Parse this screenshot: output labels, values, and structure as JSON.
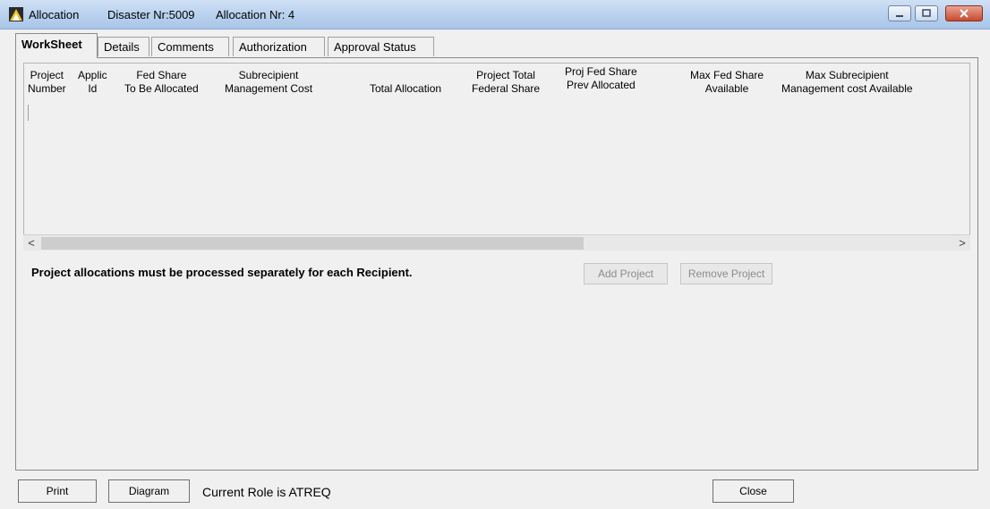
{
  "window": {
    "app_name": "Allocation",
    "disaster": "Disaster Nr:5009",
    "allocation": "Allocation Nr: 4"
  },
  "tabs": [
    {
      "label": "WorkSheet",
      "active": true
    },
    {
      "label": "Details"
    },
    {
      "label": "Comments"
    },
    {
      "label": "Authorization"
    },
    {
      "label": "Approval Status"
    }
  ],
  "grid": {
    "columns": [
      "Project\nNumber",
      "Applic\nId",
      "Fed Share\nTo Be Allocated",
      "Subrecipient\nManagement Cost",
      "Total Allocation",
      "Project Total\nFederal Share",
      "Proj Fed Share\nPrev Allocated",
      "Max Fed Share\nAvailable",
      "Max Subrecipient\nManagement cost Available"
    ],
    "rows": []
  },
  "notice": "Project allocations must be processed separately for each Recipient.",
  "buttons": {
    "add_project": "Add Project",
    "remove_project": "Remove Project",
    "print": "Print",
    "diagram": "Diagram",
    "close": "Close"
  },
  "status": {
    "role": "Current Role is ATREQ"
  },
  "icons": {
    "scroll_left": "<",
    "scroll_right": ">"
  }
}
